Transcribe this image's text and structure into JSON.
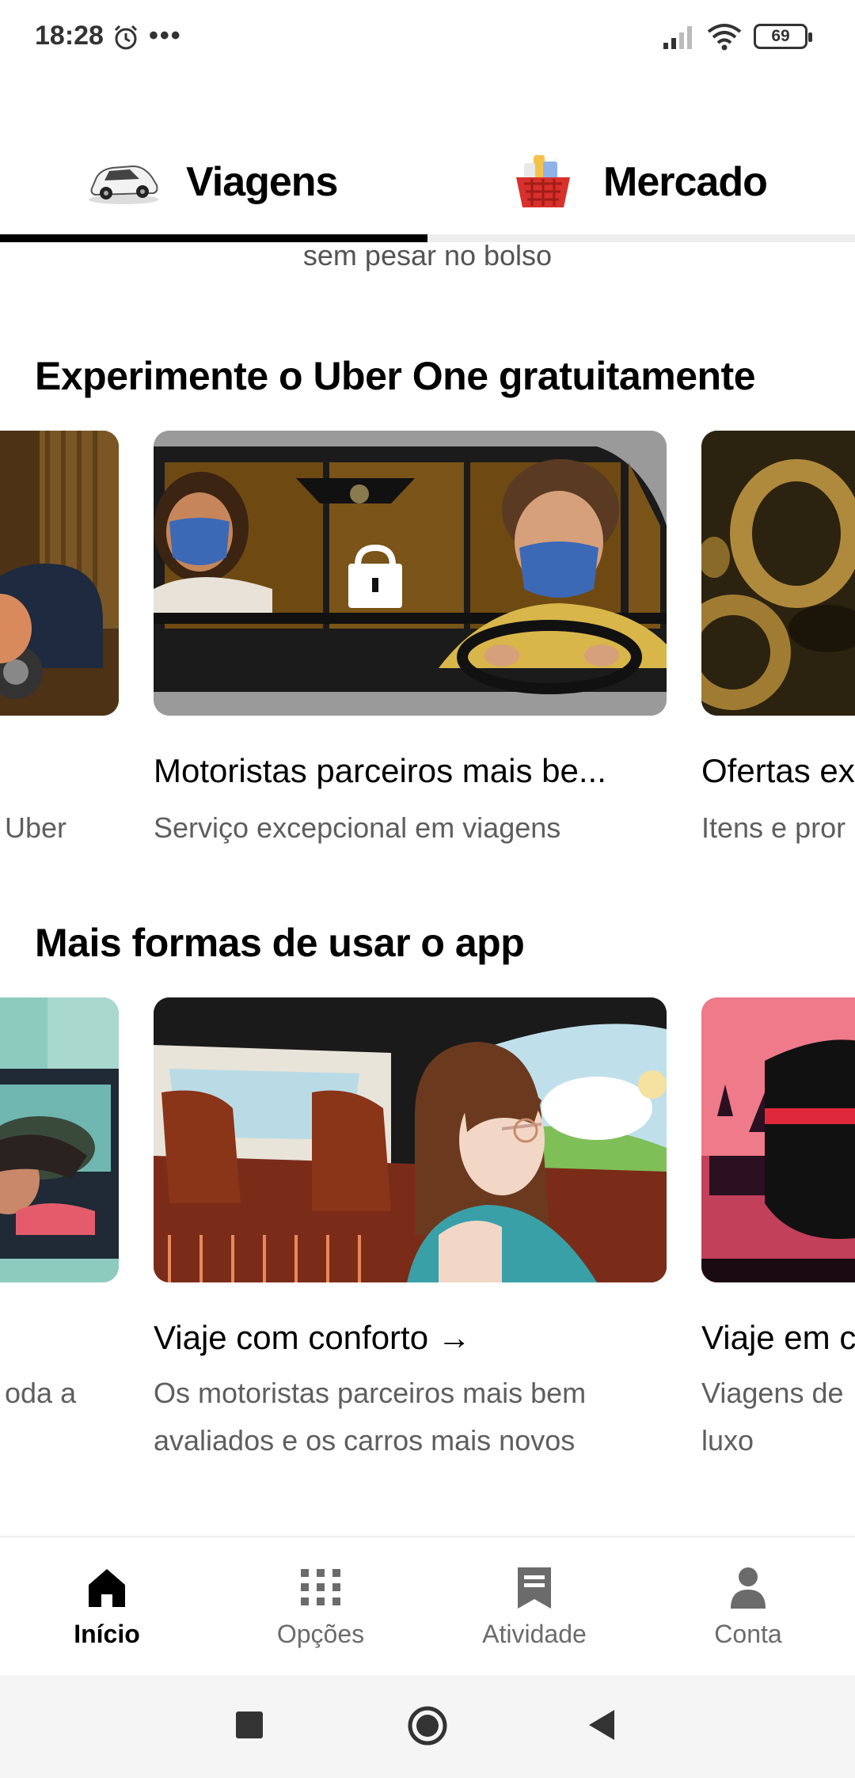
{
  "status_bar": {
    "time": "18:28",
    "dots": "•••",
    "battery": "69"
  },
  "tabs": [
    {
      "label": "Viagens",
      "active": true,
      "icon": "car-icon"
    },
    {
      "label": "Mercado",
      "active": false,
      "icon": "grocery-basket-icon"
    }
  ],
  "top_subtitle": "sem pesar no bolso",
  "section1": {
    "title": "Experimente o Uber One gratuitamente",
    "cards": [
      {
        "title": "",
        "desc": "Uber"
      },
      {
        "title": "Motoristas parceiros mais be...",
        "desc": "Serviço excepcional em viagens"
      },
      {
        "title": "Ofertas ex",
        "desc": "Itens e pror"
      }
    ]
  },
  "section2": {
    "title": "Mais formas de usar o app",
    "cards": [
      {
        "desc_lines": [
          "oda a"
        ]
      },
      {
        "title": "Viaje com conforto →",
        "desc_lines": [
          "Os motoristas parceiros mais bem",
          "avaliados e os carros mais novos"
        ]
      },
      {
        "title": "Viaje em c",
        "desc_lines": [
          "Viagens de",
          "luxo"
        ]
      }
    ]
  },
  "bottom_nav": [
    {
      "label": "Início",
      "icon": "home-icon",
      "active": true
    },
    {
      "label": "Opções",
      "icon": "grid-icon",
      "active": false
    },
    {
      "label": "Atividade",
      "icon": "receipt-icon",
      "active": false
    },
    {
      "label": "Conta",
      "icon": "person-icon",
      "active": false
    }
  ],
  "colors": {
    "accent": "#000000",
    "muted_text": "#5e5e5e",
    "inactive_nav": "#6b6b6b"
  }
}
